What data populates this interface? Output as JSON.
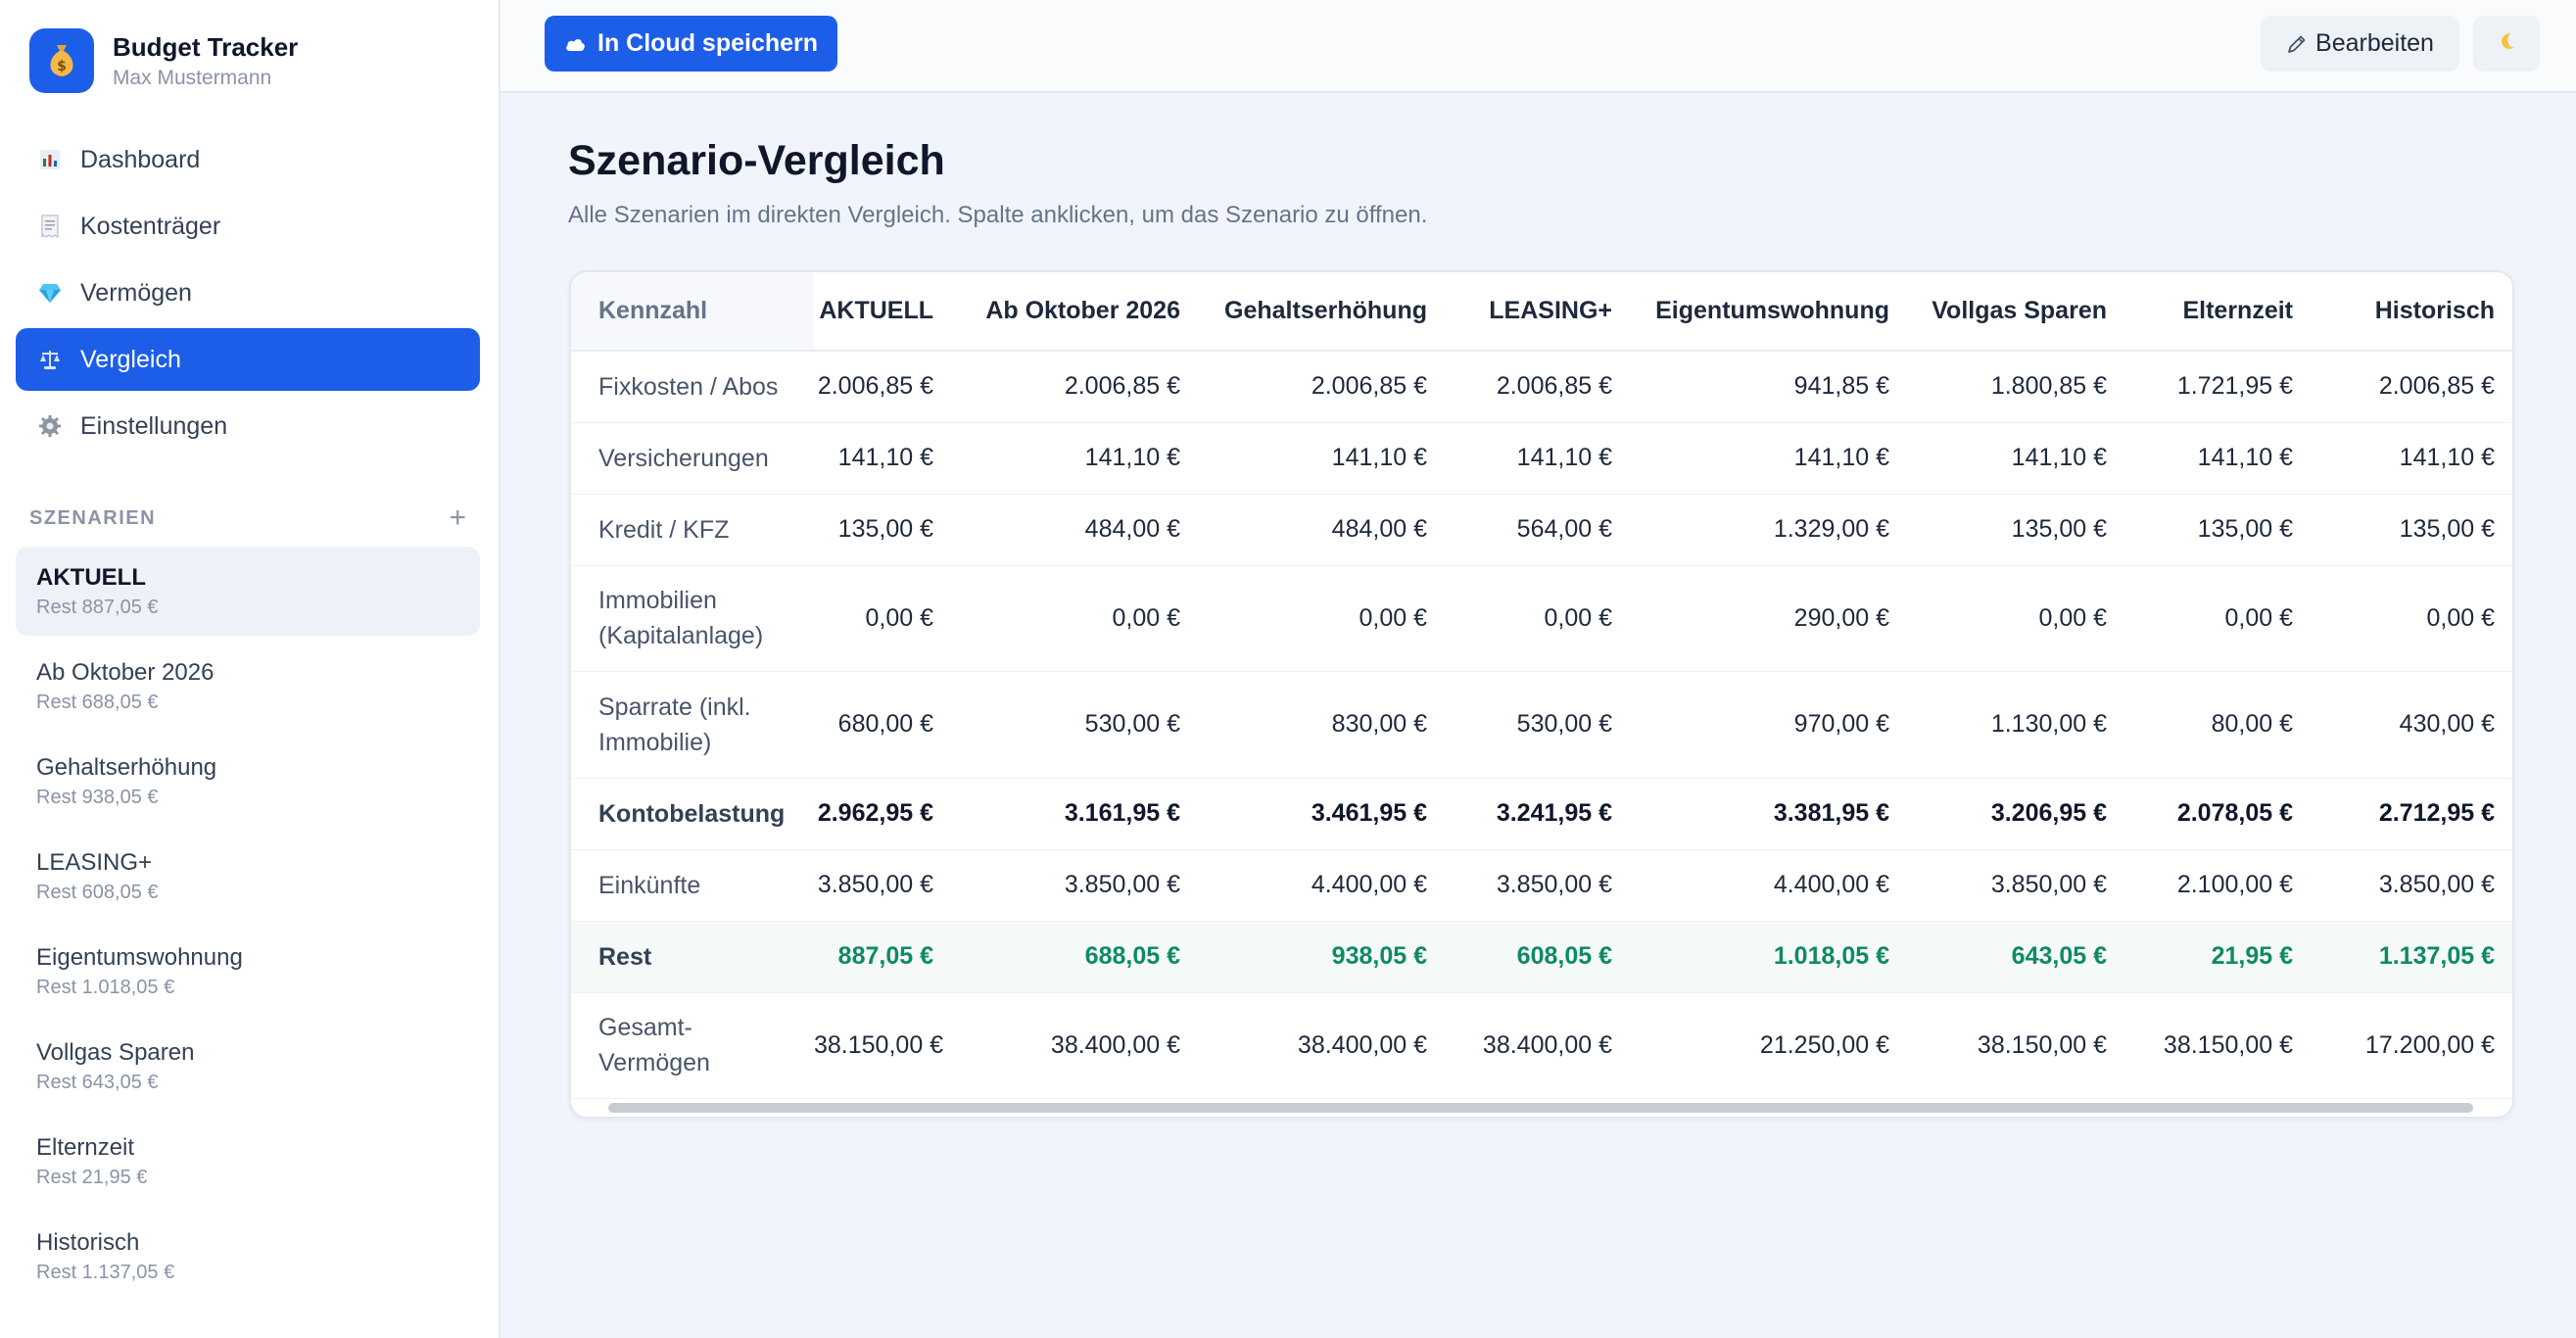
{
  "app": {
    "title": "Budget Tracker",
    "user": "Max Mustermann"
  },
  "nav": {
    "items": [
      {
        "label": "Dashboard",
        "icon": "bar-chart-icon"
      },
      {
        "label": "Kostenträger",
        "icon": "receipt-icon"
      },
      {
        "label": "Vermögen",
        "icon": "gem-icon"
      },
      {
        "label": "Vergleich",
        "icon": "scale-icon",
        "active": true
      },
      {
        "label": "Einstellungen",
        "icon": "gear-icon"
      }
    ]
  },
  "scenarios": {
    "section_title": "SZENARIEN",
    "add_symbol": "+",
    "items": [
      {
        "name": "AKTUELL",
        "rest": "Rest 887,05 €",
        "active": true
      },
      {
        "name": "Ab Oktober 2026",
        "rest": "Rest 688,05 €"
      },
      {
        "name": "Gehaltserhöhung",
        "rest": "Rest 938,05 €"
      },
      {
        "name": "LEASING+",
        "rest": "Rest 608,05 €"
      },
      {
        "name": "Eigentumswohnung",
        "rest": "Rest 1.018,05 €"
      },
      {
        "name": "Vollgas Sparen",
        "rest": "Rest 643,05 €"
      },
      {
        "name": "Elternzeit",
        "rest": "Rest 21,95 €"
      },
      {
        "name": "Historisch",
        "rest": "Rest 1.137,05 €"
      }
    ]
  },
  "toolbar": {
    "cloud_label": "In Cloud speichern",
    "edit_label": "Bearbeiten"
  },
  "page": {
    "title": "Szenario-Vergleich",
    "subtitle": "Alle Szenarien im direkten Vergleich. Spalte anklicken, um das Szenario zu öffnen."
  },
  "table": {
    "corner_label": "Kennzahl",
    "columns": [
      "AKTUELL",
      "Ab Oktober 2026",
      "Gehaltserhöhung",
      "LEASING+",
      "Eigentumswohnung",
      "Vollgas Sparen",
      "Elternzeit",
      "Historisch"
    ],
    "rows": [
      {
        "label": "Fixkosten / Abos",
        "values": [
          "2.006,85 €",
          "2.006,85 €",
          "2.006,85 €",
          "2.006,85 €",
          "941,85 €",
          "1.800,85 €",
          "1.721,95 €",
          "2.006,85 €"
        ]
      },
      {
        "label": "Versicherungen",
        "values": [
          "141,10 €",
          "141,10 €",
          "141,10 €",
          "141,10 €",
          "141,10 €",
          "141,10 €",
          "141,10 €",
          "141,10 €"
        ]
      },
      {
        "label": "Kredit / KFZ",
        "values": [
          "135,00 €",
          "484,00 €",
          "484,00 €",
          "564,00 €",
          "1.329,00 €",
          "135,00 €",
          "135,00 €",
          "135,00 €"
        ]
      },
      {
        "label": "Immobilien (Kapitalanlage)",
        "values": [
          "0,00 €",
          "0,00 €",
          "0,00 €",
          "0,00 €",
          "290,00 €",
          "0,00 €",
          "0,00 €",
          "0,00 €"
        ]
      },
      {
        "label": "Sparrate (inkl. Immobilie)",
        "values": [
          "680,00 €",
          "530,00 €",
          "830,00 €",
          "530,00 €",
          "970,00 €",
          "1.130,00 €",
          "80,00 €",
          "430,00 €"
        ]
      },
      {
        "label": "Kontobelastung",
        "style": "bold",
        "values": [
          "2.962,95 €",
          "3.161,95 €",
          "3.461,95 €",
          "3.241,95 €",
          "3.381,95 €",
          "3.206,95 €",
          "2.078,05 €",
          "2.712,95 €"
        ]
      },
      {
        "label": "Einkünfte",
        "values": [
          "3.850,00 €",
          "3.850,00 €",
          "4.400,00 €",
          "3.850,00 €",
          "4.400,00 €",
          "3.850,00 €",
          "2.100,00 €",
          "3.850,00 €"
        ]
      },
      {
        "label": "Rest",
        "style": "rest",
        "values": [
          "887,05 €",
          "688,05 €",
          "938,05 €",
          "608,05 €",
          "1.018,05 €",
          "643,05 €",
          "21,95 €",
          "1.137,05 €"
        ]
      },
      {
        "label": "Gesamt-Vermögen",
        "values": [
          "38.150,00 €",
          "38.400,00 €",
          "38.400,00 €",
          "38.400,00 €",
          "21.250,00 €",
          "38.150,00 €",
          "38.150,00 €",
          "17.200,00 €"
        ]
      }
    ]
  },
  "colors": {
    "accent": "#1d5ee8",
    "positive": "#0f8a63"
  }
}
